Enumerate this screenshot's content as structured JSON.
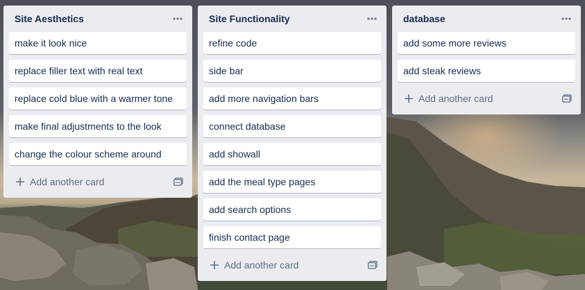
{
  "lists": [
    {
      "title": "Site Aesthetics",
      "cards": [
        "make it look nice",
        "replace filler text with real text",
        "replace cold blue with a warmer tone",
        "make final adjustments to the look",
        "change the colour scheme around"
      ],
      "add_label": "Add another card"
    },
    {
      "title": "Site Functionality",
      "cards": [
        "refine code",
        "side bar",
        "add more navigation bars",
        "connect database",
        "add showall",
        "add the meal type pages",
        "add search options",
        "finish contact page"
      ],
      "add_label": "Add another card"
    },
    {
      "title": "database",
      "cards": [
        "add some more reviews",
        "add steak reviews"
      ],
      "add_label": "Add another card"
    }
  ],
  "icons": {
    "list_menu": "ellipsis-icon",
    "add": "plus-icon",
    "template": "card-template-icon"
  },
  "colors": {
    "list_bg": "#ebecf0",
    "card_bg": "#ffffff",
    "title_text": "#172b4d",
    "muted_text": "#5e6c84"
  }
}
